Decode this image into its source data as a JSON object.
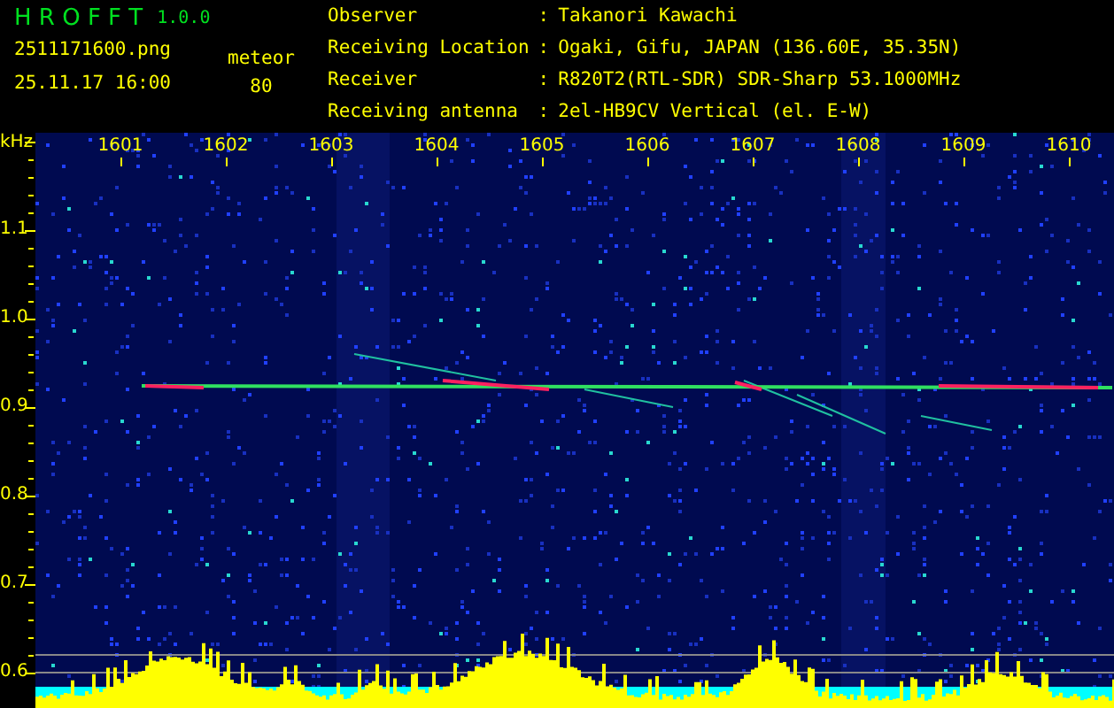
{
  "app": {
    "name": "H R O F F T",
    "version": "1.0.0"
  },
  "file_name": "2511171600.png",
  "timestamp": "25.11.17 16:00",
  "mode": {
    "label": "meteor",
    "count": "80"
  },
  "info": [
    {
      "label": "Observer",
      "separator": ":",
      "value": "Takanori Kawachi"
    },
    {
      "label": "Receiving Location",
      "separator": ":",
      "value": "Ogaki, Gifu, JAPAN (136.60E, 35.35N)"
    },
    {
      "label": "Receiver",
      "separator": ":",
      "value": "R820T2(RTL-SDR) SDR-Sharp 53.1000MHz"
    },
    {
      "label": "Receiving antenna",
      "separator": ":",
      "value": "2el-HB9CV Vertical (el. E-W)"
    }
  ],
  "spectrogram": {
    "y_unit": "kHz",
    "x_labels": [
      "1601",
      "1602",
      "1603",
      "1604",
      "1605",
      "1606",
      "1607",
      "1608",
      "1609",
      "1610"
    ],
    "y_labels": [
      "1.1",
      "1.0",
      "0.9",
      "0.8",
      "0.7",
      "0.6"
    ]
  }
}
